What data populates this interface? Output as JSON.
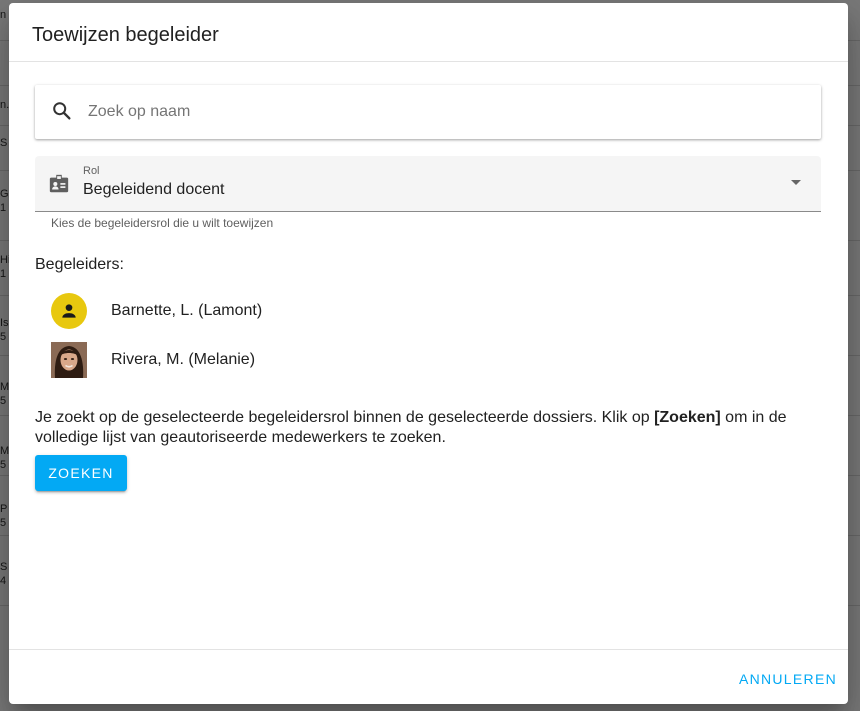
{
  "background": {
    "fragments": [
      "n",
      "n.",
      "S",
      "G",
      "1",
      "Hi",
      "1",
      "Is",
      "5",
      "M",
      "5",
      "M",
      "5",
      "P",
      "5",
      "S",
      "4"
    ]
  },
  "dialog": {
    "title": "Toewijzen begeleider",
    "search": {
      "icon": "search-icon",
      "placeholder": "Zoek op naam",
      "value": ""
    },
    "role_select": {
      "icon": "badge-icon",
      "label": "Rol",
      "value": "Begeleidend docent",
      "hint": "Kies de begeleidersrol die u wilt toewijzen"
    },
    "coaches_label": "Begeleiders:",
    "coaches": [
      {
        "name": "Barnette, L. (Lamont)",
        "avatar": "person-icon",
        "avatar_color": "#e8c80f"
      },
      {
        "name": "Rivera, M. (Melanie)",
        "avatar": "photo"
      }
    ],
    "info": {
      "before": "Je zoekt op de geselecteerde begeleidersrol binnen de geselecteerde dossiers. Klik op ",
      "bold": "[Zoeken]",
      "after": " om in de volledige lijst van geautoriseerde medewerkers te zoeken."
    },
    "search_button": "ZOEKEN",
    "cancel_button": "ANNULEREN"
  },
  "colors": {
    "accent": "#03a9f4",
    "avatar_yellow": "#e8c80f",
    "scrim": "rgba(0,0,0,0.52)"
  }
}
